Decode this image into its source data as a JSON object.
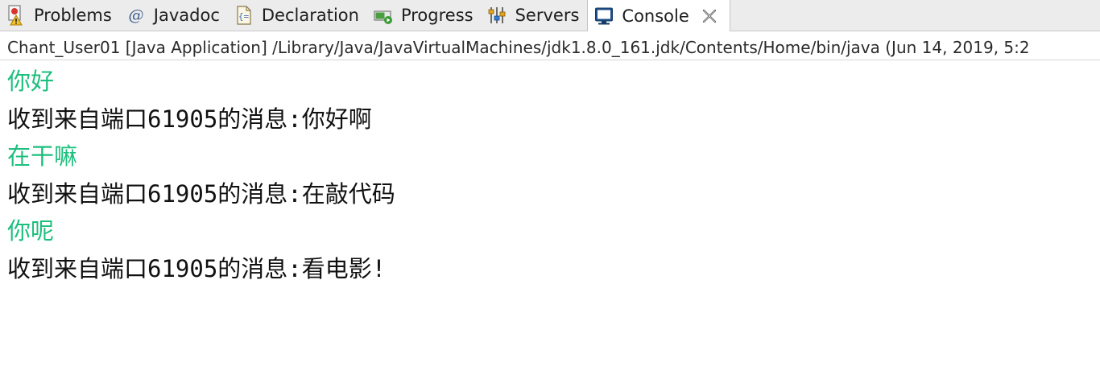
{
  "tabs": [
    {
      "label": "Problems",
      "icon": "problems-icon",
      "active": false
    },
    {
      "label": "Javadoc",
      "icon": "javadoc-icon",
      "active": false
    },
    {
      "label": "Declaration",
      "icon": "declaration-icon",
      "active": false
    },
    {
      "label": "Progress",
      "icon": "progress-icon",
      "active": false
    },
    {
      "label": "Servers",
      "icon": "servers-icon",
      "active": false
    },
    {
      "label": "Console",
      "icon": "console-icon",
      "active": true
    }
  ],
  "console": {
    "status": "Chant_User01 [Java Application] /Library/Java/JavaVirtualMachines/jdk1.8.0_161.jdk/Contents/Home/bin/java (Jun 14, 2019, 5:2",
    "lines": [
      {
        "text": "你好",
        "kind": "input"
      },
      {
        "text": "收到来自端口61905的消息:你好啊",
        "kind": "output"
      },
      {
        "text": "在干嘛",
        "kind": "input"
      },
      {
        "text": "收到来自端口61905的消息:在敲代码",
        "kind": "output"
      },
      {
        "text": "你呢",
        "kind": "input"
      },
      {
        "text": "收到来自端口61905的消息:看电影!",
        "kind": "output"
      }
    ]
  },
  "colors": {
    "input_text": "#1dbf7e",
    "output_text": "#111111",
    "tabbar_bg": "#ececec"
  }
}
